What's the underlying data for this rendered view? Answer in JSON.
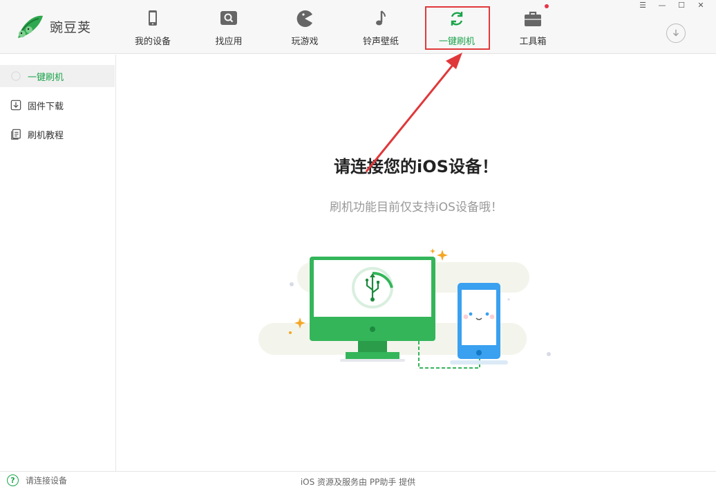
{
  "app": {
    "title": "豌豆荚"
  },
  "nav": {
    "items": [
      {
        "label": "我的设备",
        "icon": "phone-icon"
      },
      {
        "label": "找应用",
        "icon": "search-app-icon"
      },
      {
        "label": "玩游戏",
        "icon": "pacman-icon"
      },
      {
        "label": "铃声壁纸",
        "icon": "music-note-icon"
      },
      {
        "label": "一键刷机",
        "icon": "refresh-icon",
        "active": true
      },
      {
        "label": "工具箱",
        "icon": "toolbox-icon"
      }
    ]
  },
  "window_controls": {
    "menu": "☰",
    "minimize": "—",
    "maximize": "☐",
    "close": "✕"
  },
  "sidebar": {
    "items": [
      {
        "label": "一键刷机",
        "active": true
      },
      {
        "label": "固件下载"
      },
      {
        "label": "刷机教程"
      }
    ]
  },
  "main": {
    "headline": "请连接您的iOS设备！",
    "subline": "刷机功能目前仅支持iOS设备哦！"
  },
  "status": {
    "left_text": "请连接设备",
    "left_icon": "?",
    "center_text": "iOS 资源及服务由 PP助手 提供"
  },
  "colors": {
    "accent": "#1aa34a",
    "highlight": "#e0383a",
    "phone": "#3aa0f0",
    "monitor": "#34b55a"
  }
}
